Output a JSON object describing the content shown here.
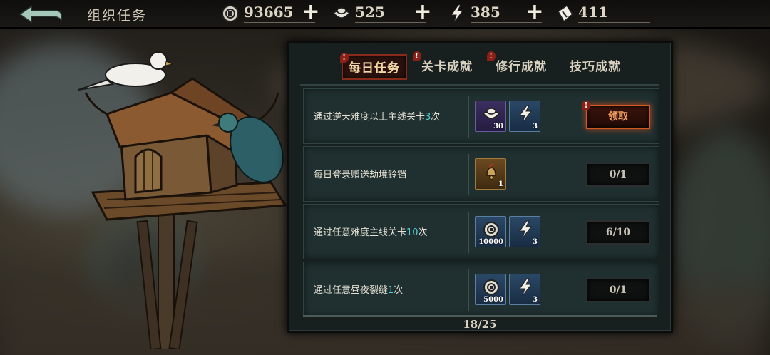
{
  "header": {
    "title": "组织任务",
    "resources": [
      {
        "icon": "coin-icon",
        "value": "93665"
      },
      {
        "icon": "silver-ingot-icon",
        "value": "525"
      },
      {
        "icon": "lightning-icon",
        "value": "385"
      },
      {
        "icon": "ticket-icon",
        "value": "411"
      }
    ],
    "plus": "+"
  },
  "tabs": [
    {
      "label": "每日任务",
      "active": true,
      "alert": true
    },
    {
      "label": "关卡成就",
      "active": false,
      "alert": true
    },
    {
      "label": "修行成就",
      "active": false,
      "alert": true
    },
    {
      "label": "技巧成就",
      "active": false,
      "alert": false
    }
  ],
  "alert_mark": "!",
  "tasks": [
    {
      "desc_pre": "通过逆天难度以上主线关卡",
      "desc_num": "3",
      "desc_post": "次",
      "rewards": [
        {
          "icon": "silver-ingot-icon",
          "count": "30",
          "color": "purple"
        },
        {
          "icon": "lightning-icon",
          "count": "3",
          "color": "blue"
        }
      ],
      "action": "领取",
      "claimable": true
    },
    {
      "desc_pre": "每日登录赠送劫境铃铛",
      "desc_num": "",
      "desc_post": "",
      "rewards": [
        {
          "icon": "bell-icon",
          "count": "1",
          "color": "gold"
        }
      ],
      "action": "0/1",
      "claimable": false
    },
    {
      "desc_pre": "通过任意难度主线关卡",
      "desc_num": "10",
      "desc_post": "次",
      "rewards": [
        {
          "icon": "coin-icon",
          "count": "10000",
          "color": "blue"
        },
        {
          "icon": "lightning-icon",
          "count": "3",
          "color": "blue"
        }
      ],
      "action": "6/10",
      "claimable": false
    },
    {
      "desc_pre": "通过任意昼夜裂缝",
      "desc_num": "1",
      "desc_post": "次",
      "rewards": [
        {
          "icon": "coin-icon",
          "count": "5000",
          "color": "blue"
        },
        {
          "icon": "lightning-icon",
          "count": "3",
          "color": "blue"
        }
      ],
      "action": "0/1",
      "claimable": false
    }
  ],
  "footer": {
    "progress": "18/25"
  },
  "colors": {
    "accent": "#4fd1dc",
    "claim": "#d05a22",
    "active_tab": "#8a2a1b"
  }
}
